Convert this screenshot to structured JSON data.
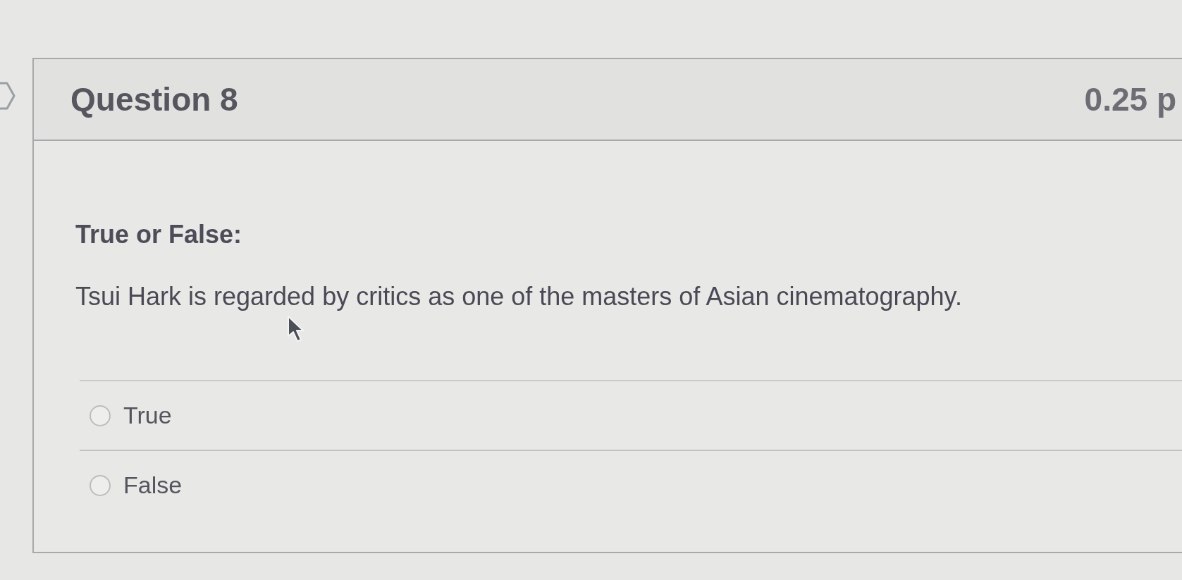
{
  "question": {
    "title": "Question 8",
    "points": "0.25 p",
    "prompt": "True or False:",
    "statement": "Tsui Hark is regarded by critics as one of the masters of Asian cinematography.",
    "options": [
      {
        "label": "True",
        "selected": false
      },
      {
        "label": "False",
        "selected": false
      }
    ]
  }
}
